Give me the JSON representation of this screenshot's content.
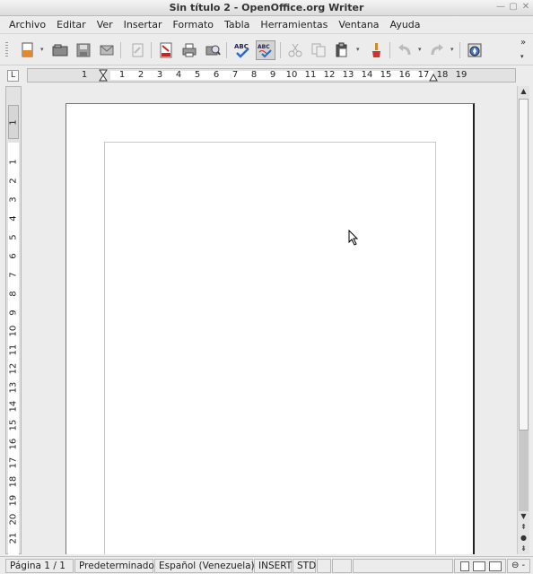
{
  "window": {
    "title": "Sin título 2 - OpenOffice.org Writer"
  },
  "menu": {
    "items": [
      "Archivo",
      "Editar",
      "Ver",
      "Insertar",
      "Formato",
      "Tabla",
      "Herramientas",
      "Ventana",
      "Ayuda"
    ]
  },
  "toolbar": {
    "overflow_label": "»"
  },
  "ruler": {
    "tab_selector": "L",
    "horizontal_numbers": [
      "1",
      "1",
      "2",
      "3",
      "4",
      "5",
      "6",
      "7",
      "8",
      "9",
      "10",
      "11",
      "12",
      "13",
      "14",
      "15",
      "16",
      "17",
      "18",
      "19"
    ],
    "vertical_top_number": "1",
    "vertical_numbers": [
      "1",
      "2",
      "3",
      "4",
      "5",
      "6",
      "7",
      "8",
      "9",
      "10",
      "11",
      "12",
      "13",
      "14",
      "15",
      "16",
      "17",
      "18",
      "19",
      "20",
      "21"
    ]
  },
  "status": {
    "page": "Página  1 / 1",
    "style": "Predeterminado",
    "language": "Español (Venezuela)",
    "insert_mode": "INSERT",
    "selection_mode": "STD"
  },
  "icons": [
    "new-icon",
    "open-icon",
    "save-icon",
    "email-icon",
    "edit-file-icon",
    "pdf-icon",
    "print-icon",
    "print-preview-icon",
    "spellcheck-icon",
    "autospellcheck-icon",
    "cut-icon",
    "copy-icon",
    "paste-icon",
    "format-paintbrush-icon",
    "undo-icon",
    "redo-icon",
    "navigator-icon"
  ]
}
